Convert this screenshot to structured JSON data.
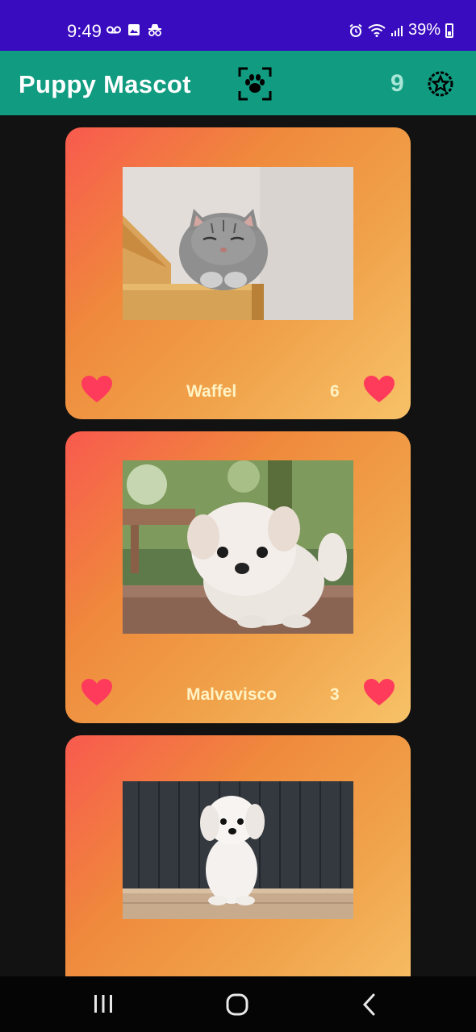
{
  "status_bar": {
    "time": "9:49",
    "battery": "39%",
    "left_icons": [
      "voicemail-icon",
      "image-icon",
      "incognito-icon"
    ],
    "right_icons": [
      "alarm-icon",
      "wifi-icon",
      "signal-icon",
      "battery-icon"
    ]
  },
  "app_bar": {
    "title": "Puppy Mascot",
    "scan_icon": "paw-scan-icon",
    "count": "9",
    "star_icon": "star-badge-icon",
    "color": "#119b80"
  },
  "pets": [
    {
      "name": "Waffel",
      "votes": "6",
      "photo": "cat-on-shelf"
    },
    {
      "name": "Malvavisco",
      "votes": "3",
      "photo": "white-puppy-outdoors"
    },
    {
      "name": "",
      "votes": "",
      "photo": "white-puppy-on-porch"
    }
  ],
  "nav_bar": {
    "buttons": [
      "recents-icon",
      "home-icon",
      "back-icon"
    ]
  },
  "colors": {
    "status_bar": "#3a0cbf",
    "heart": "#ff3b5c",
    "card_gradient_start": "#f85a4e",
    "card_gradient_end": "#f8c268",
    "background": "#121212"
  }
}
